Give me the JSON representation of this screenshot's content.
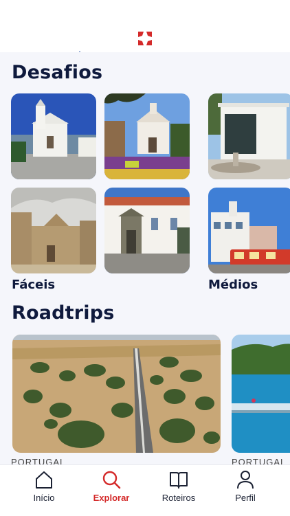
{
  "brand": {
    "accent": "#d42a2a",
    "logo_icon": "clover-logo-icon"
  },
  "sections": {
    "challenges": {
      "title": "Desafios",
      "groups": [
        {
          "label": "Fáceis"
        },
        {
          "label": "Médios"
        }
      ]
    },
    "roadtrips": {
      "title": "Roadtrips",
      "cards": [
        {
          "country": "PORTUGAL"
        },
        {
          "country": "PORTUGAL"
        }
      ]
    }
  },
  "tabs": [
    {
      "label": "Início",
      "icon": "home-icon",
      "active": false
    },
    {
      "label": "Explorar",
      "icon": "search-icon",
      "active": true
    },
    {
      "label": "Roteiros",
      "icon": "book-icon",
      "active": false
    },
    {
      "label": "Perfil",
      "icon": "user-icon",
      "active": false
    }
  ]
}
